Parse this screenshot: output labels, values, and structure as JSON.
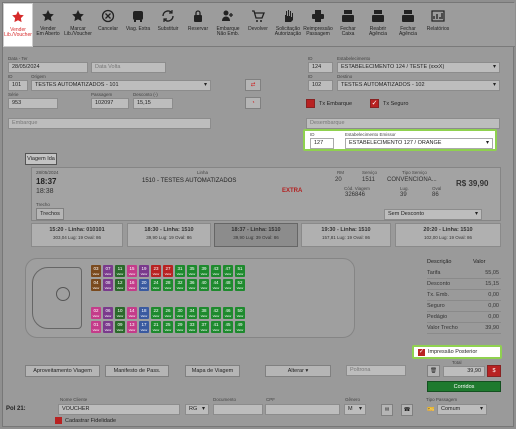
{
  "toolbar": [
    {
      "label": "Vender\nLib./Voucher",
      "icon": "star-plus-icon"
    },
    {
      "label": "Vender\nEm Aberto",
      "icon": "star-icon"
    },
    {
      "label": "Marcar\nLib./Voucher",
      "icon": "star-icon"
    },
    {
      "label": "Cancelar",
      "icon": "cancel-icon"
    },
    {
      "label": "Viag. Extra",
      "icon": "bus-icon"
    },
    {
      "label": "Substituir",
      "icon": "refresh-icon"
    },
    {
      "label": "Reservar",
      "icon": "lock-icon"
    },
    {
      "label": "Embarque\nNão Emb.",
      "icon": "user-plus-icon"
    },
    {
      "label": "Devolver",
      "icon": "cart-icon"
    },
    {
      "label": "Solicitação\nAutorização",
      "icon": "hand-icon"
    },
    {
      "label": "Reimpressão\nPassagem",
      "icon": "printer-icon"
    },
    {
      "label": "Fechar\nCaixa",
      "icon": "cash-register-icon"
    },
    {
      "label": "Reabrir\nAgência",
      "icon": "cash-register-icon"
    },
    {
      "label": "Fechar\nAgência",
      "icon": "cash-register-icon"
    },
    {
      "label": "Relatórios",
      "icon": "chart-icon"
    }
  ],
  "form": {
    "data_label": "Data - Ter",
    "data_value": "28/05/2024",
    "data_volta_placeholder": "Data Volta",
    "id_label": "ID",
    "origem_id": "101",
    "origem_label": "Origem",
    "origem_value": "TESTES AUTOMATIZADOS - 101",
    "serie_label": "Série",
    "serie_value": "953",
    "passagem_label": "Passagem",
    "passagem_value": "102097",
    "desconto_label": "Desconto (-)",
    "desconto_value": "15,15",
    "embarque_placeholder": "Embarque",
    "estab_label": "Estabelecimento",
    "estab_id": "124",
    "estab_value": "ESTABELECIMENTO 124 / TESTE (xxxX)",
    "destino_label": "Destino",
    "destino_id": "102",
    "destino_value": "TESTES AUTOMATIZADOS - 102",
    "tx_embarque": "Tx Embarque",
    "tx_seguro": "Tx Seguro",
    "desembarque_placeholder": "Desembarque",
    "emissor_id_label": "ID",
    "emissor_id": "127",
    "emissor_label": "Estabelecimento Emissor",
    "emissor_value": "ESTABELECIMENTO 127 / ORANGE"
  },
  "viagem_tab": "Viagem Ida",
  "trip": {
    "date": "28/05/2024",
    "time": "18:37",
    "time2": "18:38",
    "linha_label": "Linha",
    "linha_value": "1510 - TESTES AUTOMATIZADOS",
    "extra": "EXTRA",
    "rm_label": "RM",
    "rm_value": "20",
    "servico_label": "Serviço",
    "servico_value": "1511",
    "tipo_servico_label": "Tipo Serviço",
    "tipo_servico_value": "CONVENCIONA...",
    "price": "R$ 39,90",
    "cod_viagem_label": "Cód. Viagem",
    "cod_viagem_value": "326846",
    "lug_label": "Lug.",
    "lug_value": "39",
    "oval_label": "Oval",
    "oval_value": "86",
    "trecho_label": "Trecho",
    "trecho_value": "Trechos",
    "desconto_select": "Sem Desconto"
  },
  "trips": [
    {
      "t1": "15:20 - Linha: 010101",
      "t2": "303,04  Lug: 19  Oval: 86"
    },
    {
      "t1": "18:30 - Linha: 1510",
      "t2": "39,90  Lug: 19  Oval: 86"
    },
    {
      "t1": "18:37 - Linha: 1510",
      "t2": "39,90  Lug: 39  Oval: 86"
    },
    {
      "t1": "19:30 - Linha: 1510",
      "t2": "157,81  Lug: 19  Oval: 86"
    },
    {
      "t1": "20:20 - Linha: 1510",
      "t2": "102,00  Lug: 19  Oval: 86"
    }
  ],
  "seats_top": [
    "03",
    "07",
    "11",
    "15",
    "19",
    "23",
    "27",
    "31",
    "35",
    "39",
    "43",
    "47",
    "51"
  ],
  "seats_top2": [
    "04",
    "08",
    "12",
    "16",
    "20",
    "24",
    "28",
    "32",
    "36",
    "40",
    "44",
    "48",
    "52"
  ],
  "seats_bot": [
    "02",
    "06",
    "10",
    "14",
    "18",
    "22",
    "26",
    "30",
    "34",
    "38",
    "42",
    "46",
    "50"
  ],
  "seats_bot2": [
    "01",
    "05",
    "09",
    "13",
    "17",
    "21",
    "25",
    "29",
    "33",
    "37",
    "41",
    "45",
    "49"
  ],
  "seat_sub": "Valor",
  "summary": {
    "h_desc": "Descrição",
    "h_val": "Valor",
    "rows": [
      {
        "d": "Tarifa",
        "v": "55,05"
      },
      {
        "d": "Desconto",
        "v": "15,15"
      },
      {
        "d": "Tx. Emb.",
        "v": "0,00"
      },
      {
        "d": "Seguro",
        "v": "0,00"
      },
      {
        "d": "Pedágio",
        "v": "0,00"
      },
      {
        "d": "Valor Trecho",
        "v": "39,90"
      }
    ],
    "impressao": "Impressão Posterior",
    "total_label": "Total",
    "total_value": "39,90",
    "dollar": "$",
    "confirm": "Corridos"
  },
  "actions": {
    "aproveitamento": "Aproveitamento Viagem",
    "manifesto": "Manifesto de Pass.",
    "mapa": "Mapa de Viagem",
    "alterar": "Alterar",
    "poltrona_placeholder": "Poltrona"
  },
  "passenger": {
    "pol_label": "Pol 21:",
    "nome_label": "Nome Cliente",
    "nome_value": "VOUCHER",
    "doc_type": "RG",
    "documento_label": "Documento",
    "cpf_label": "CPF",
    "genero_label": "Gênero",
    "genero_value": "M",
    "tipo_label": "Tipo Passagem",
    "tipo_value": "Comum",
    "cadastrar": "Cadastrar Fidelidade"
  },
  "colors": {
    "accent_red": "#d62a2a",
    "highlight_green": "#8fd14f",
    "seat_green": "#1e8a2e",
    "seat_purple": "#7a3a8c",
    "seat_red": "#b82222",
    "seat_brown": "#7a4a1e",
    "seat_pink": "#c43c8a",
    "seat_darkgreen": "#2a6a2a",
    "seat_blue": "#3a5aa0"
  }
}
